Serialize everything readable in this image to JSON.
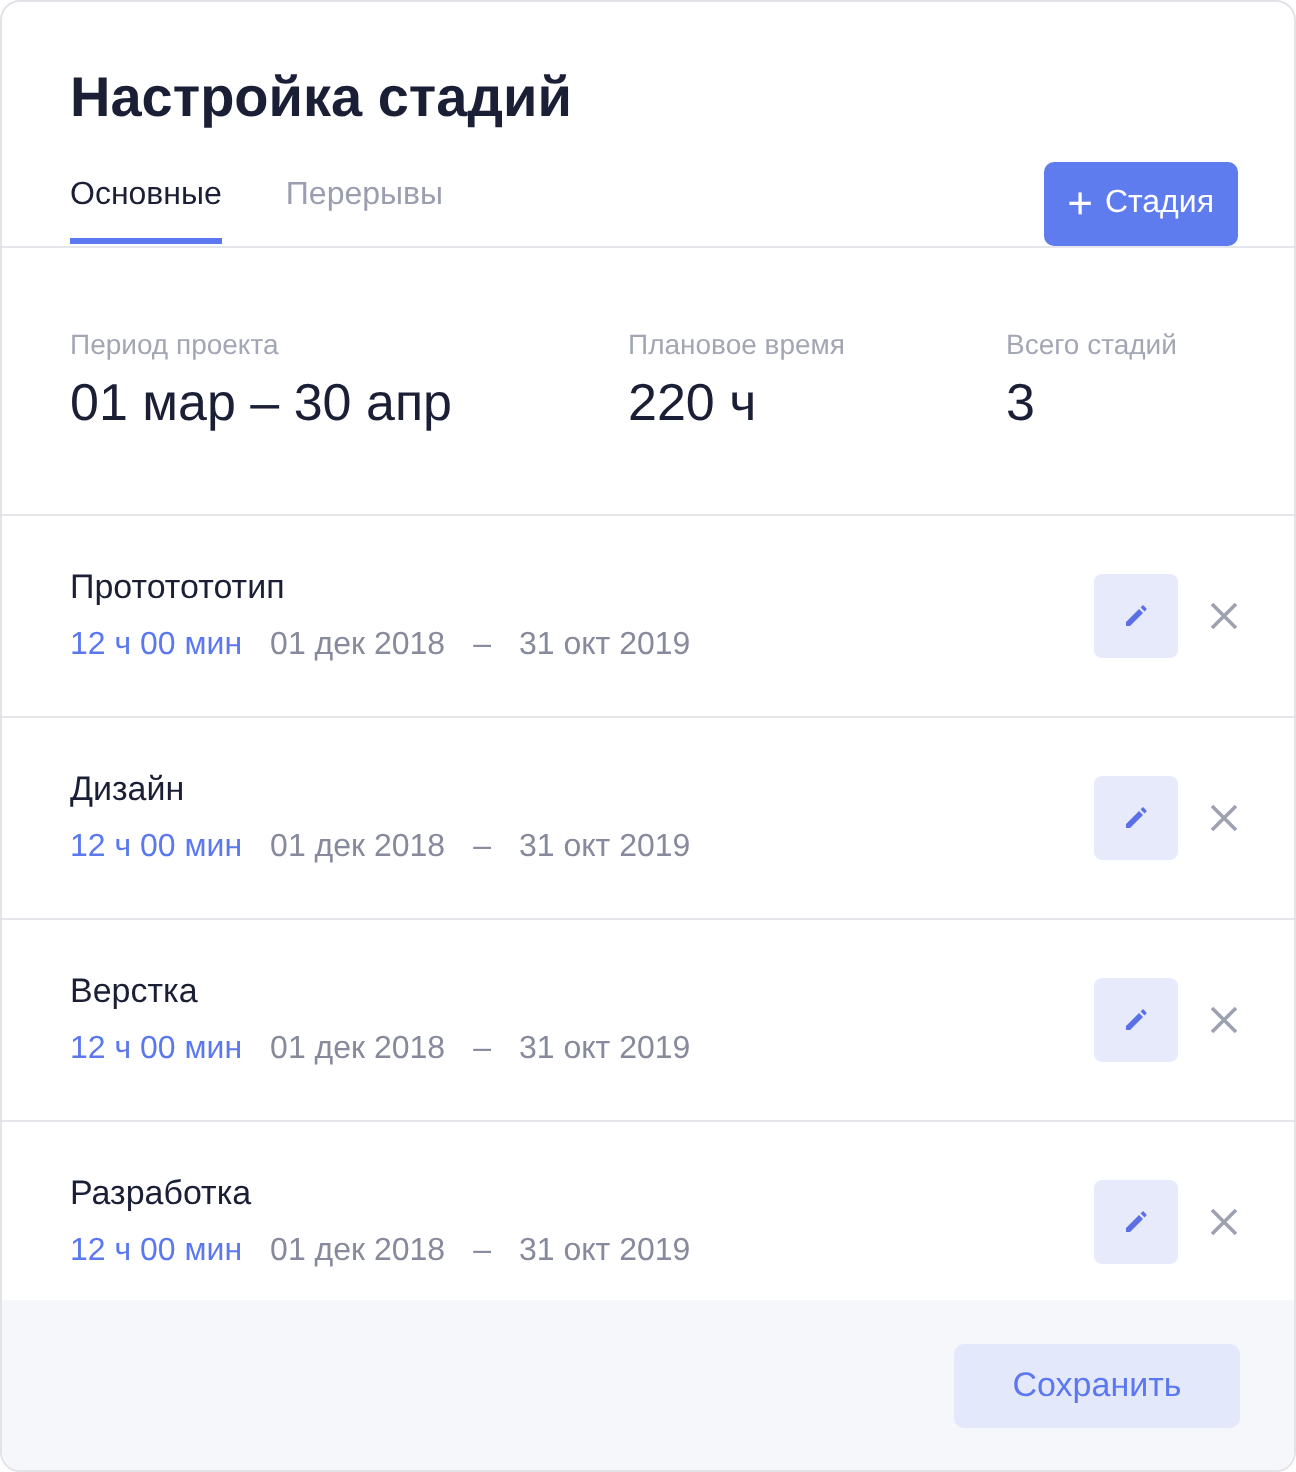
{
  "title": "Настройка стадий",
  "tabs": [
    {
      "label": "Основные",
      "selected": true
    },
    {
      "label": "Перерывы",
      "selected": false
    }
  ],
  "add_button": {
    "icon": "+",
    "label": "Стадия"
  },
  "stats": [
    {
      "label": "Период проекта",
      "value": "01 мар – 30 апр"
    },
    {
      "label": "Плановое время",
      "value": "220 ч"
    },
    {
      "label": "Всего стадий",
      "value": "3"
    }
  ],
  "stages": [
    {
      "name": "Прототототип",
      "duration": "12 ч 00 мин",
      "start": "01 дек 2018",
      "dash": "–",
      "end": "31 окт 2019"
    },
    {
      "name": "Дизайн",
      "duration": "12 ч 00 мин",
      "start": "01 дек 2018",
      "dash": "–",
      "end": "31 окт 2019"
    },
    {
      "name": "Верстка",
      "duration": "12 ч 00 мин",
      "start": "01 дек 2018",
      "dash": "–",
      "end": "31 окт 2019"
    },
    {
      "name": "Разработка",
      "duration": "12 ч 00 мин",
      "start": "01 дек 2018",
      "dash": "–",
      "end": "31 окт 2019"
    }
  ],
  "save_button": "Сохранить"
}
